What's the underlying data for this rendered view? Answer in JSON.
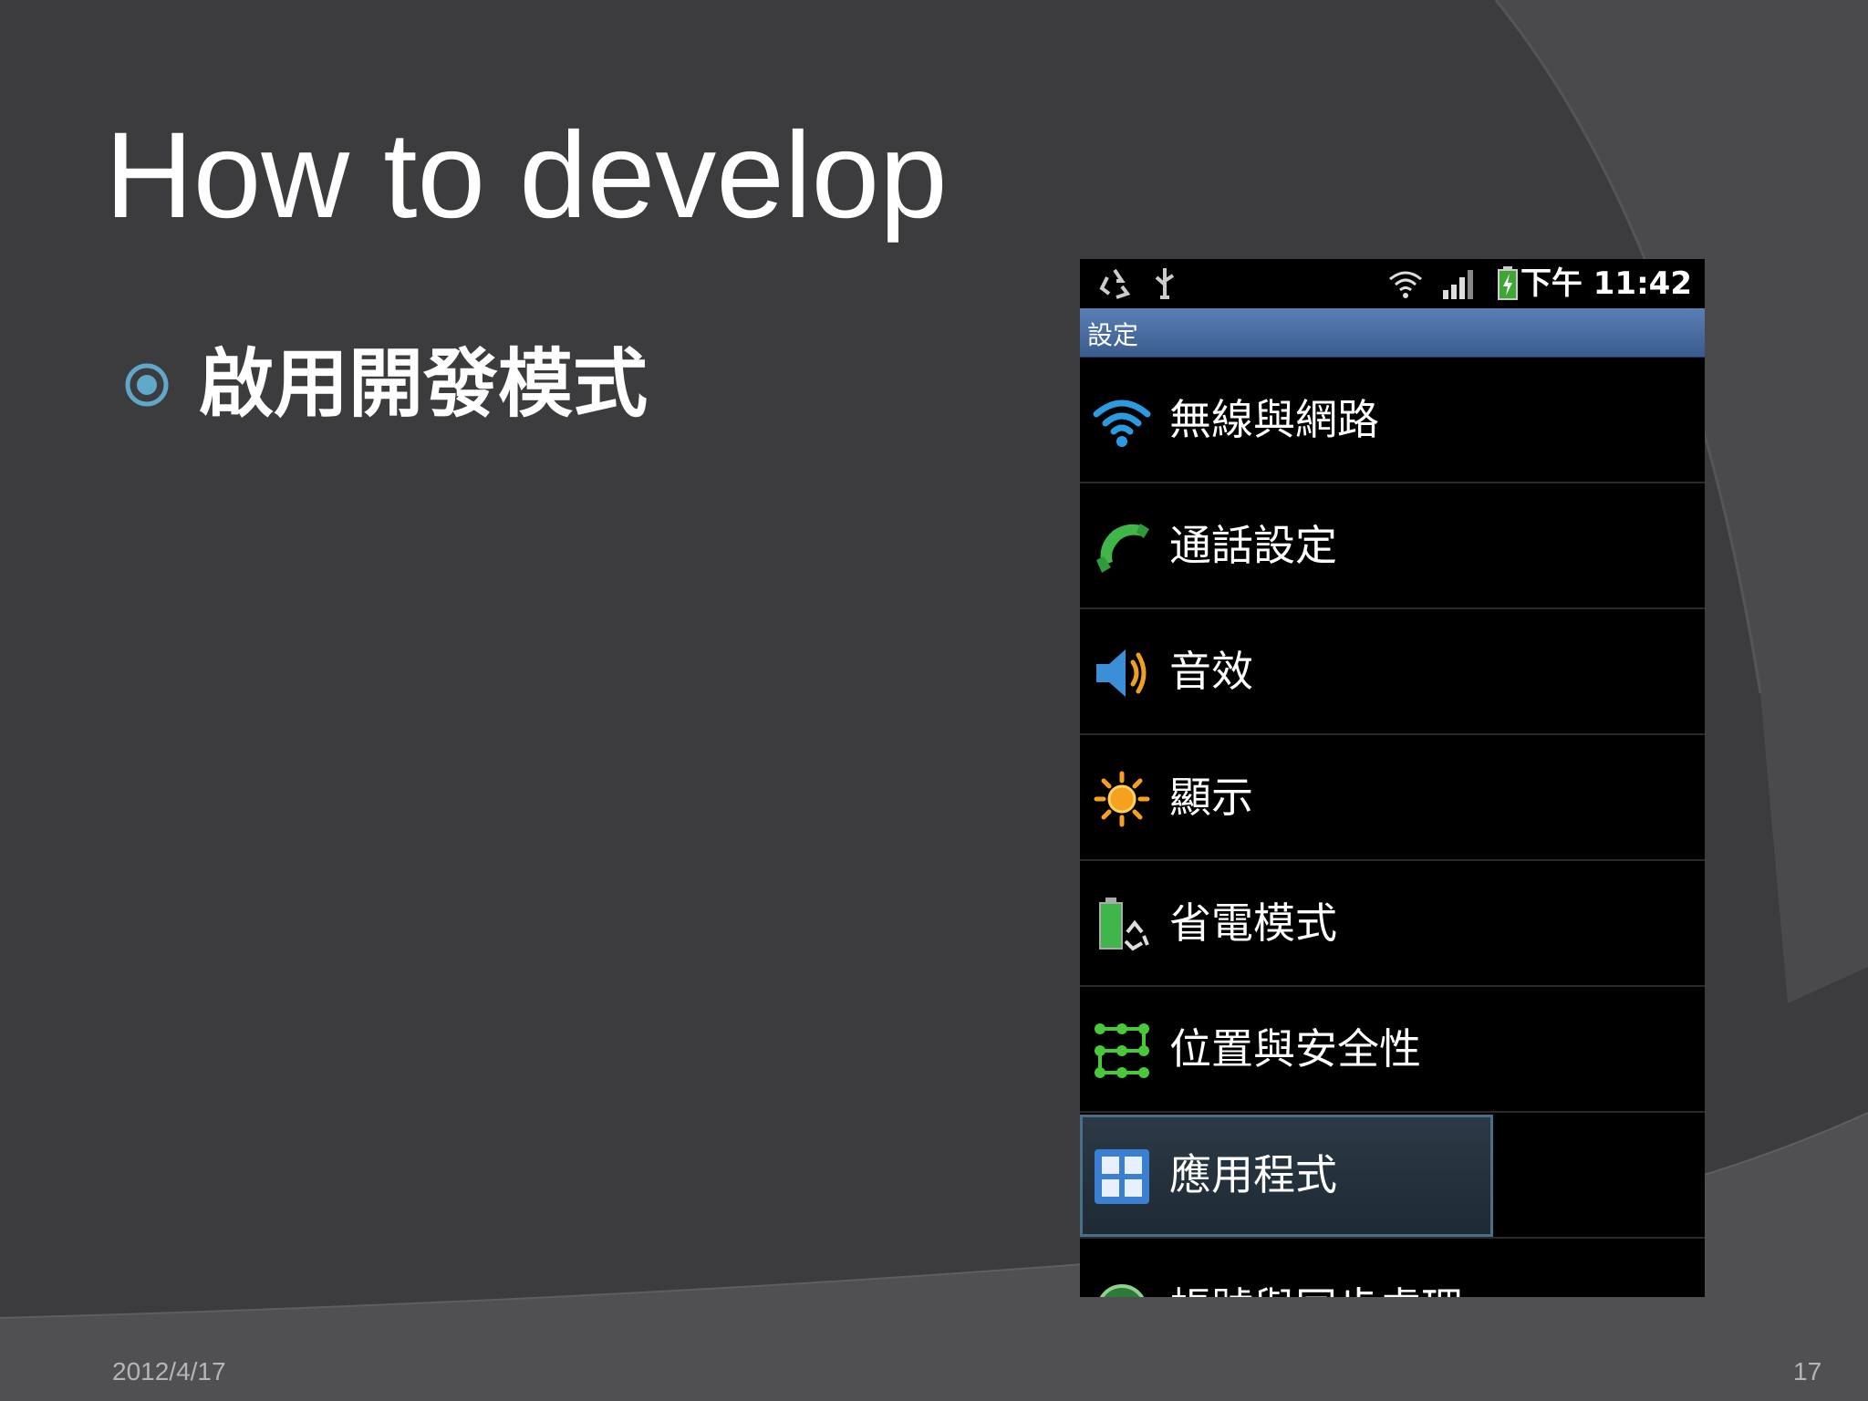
{
  "slide": {
    "title": "How to develop",
    "bullet": "啟用開發模式",
    "footer_date": "2012/4/17",
    "page_number": "17"
  },
  "phone": {
    "status_bar": {
      "time": "下午 11:42",
      "icons": [
        "recycle-icon",
        "usb-icon",
        "wifi-icon",
        "signal-icon",
        "battery-charging-icon"
      ]
    },
    "title_bar": "設定",
    "settings": [
      {
        "label": "無線與網路",
        "icon": "wifi-icon"
      },
      {
        "label": "通話設定",
        "icon": "phone-handset-icon"
      },
      {
        "label": "音效",
        "icon": "speaker-icon"
      },
      {
        "label": "顯示",
        "icon": "brightness-icon"
      },
      {
        "label": "省電模式",
        "icon": "battery-saver-icon"
      },
      {
        "label": "位置與安全性",
        "icon": "location-security-icon"
      },
      {
        "label": "應用程式",
        "icon": "apps-grid-icon",
        "selected": true
      },
      {
        "label": "帳號與同步處理",
        "icon": "sync-icon"
      }
    ]
  },
  "colors": {
    "background": "#3c3c3e",
    "title_bar": "#4a6fa5",
    "bullet_accent": "#5fa8c8",
    "selection_border": "#4a6f8a"
  }
}
